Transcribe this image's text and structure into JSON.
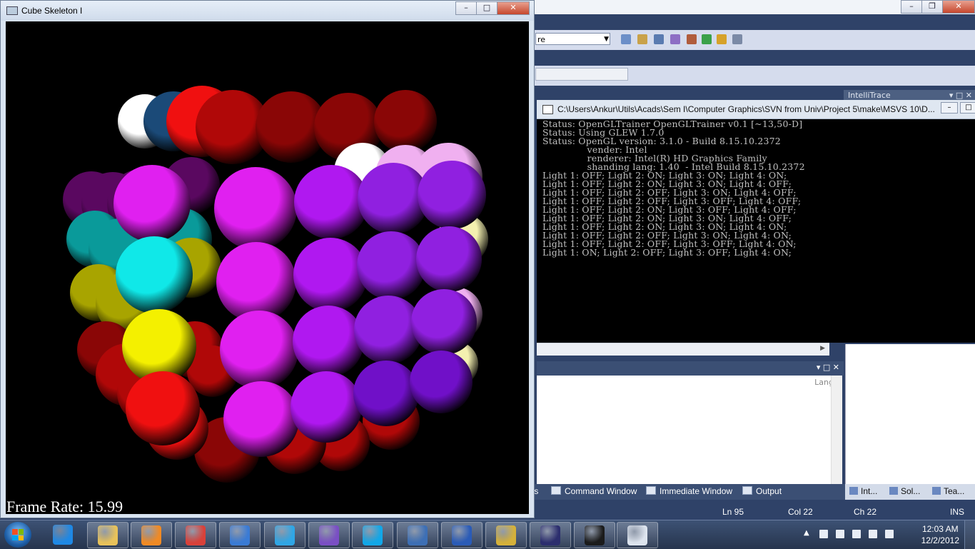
{
  "gl_window": {
    "title": "Cube Skeleton I",
    "frame_rate_text": "Frame Rate: 15.99"
  },
  "console_window": {
    "title": "C:\\Users\\Ankur\\Utils\\Acads\\Sem I\\Computer Graphics\\SVN from Univ\\Project 5\\make\\MSVS 10\\D...",
    "lines": [
      "Status: OpenGLTrainer OpenGLTrainer v0.1 [~13,50-D]",
      "Status: Using GLEW 1.7.0",
      "Status: OpenGL version: 3.1.0 - Build 8.15.10.2372",
      "               vender: Intel",
      "               renderer: Intel(R) HD Graphics Family",
      "               shanding lang: 1.40  - Intel Build 8.15.10.2372",
      "Light 1: OFF; Light 2: ON; Light 3: ON; Light 4: ON;",
      "Light 1: OFF; Light 2: ON; Light 3: ON; Light 4: OFF;",
      "Light 1: OFF; Light 2: OFF; Light 3: ON; Light 4: OFF;",
      "Light 1: OFF; Light 2: OFF; Light 3: OFF; Light 4: OFF;",
      "Light 1: OFF; Light 2: ON; Light 3: OFF; Light 4: OFF;",
      "Light 1: OFF; Light 2: ON; Light 3: ON; Light 4: OFF;",
      "Light 1: OFF; Light 2: ON; Light 3: ON; Light 4: ON;",
      "Light 1: OFF; Light 2: OFF; Light 3: ON; Light 4: ON;",
      "Light 1: OFF; Light 2: OFF; Light 3: OFF; Light 4: ON;",
      "Light 1: ON; Light 2: OFF; Light 3: OFF; Light 4: ON;"
    ]
  },
  "vs": {
    "config_combo_value": "re",
    "intellitrace_label": "IntelliTrace",
    "lang_header": "Lang",
    "bottom_tabs": [
      {
        "label": "ts",
        "icon": "tool-icon"
      },
      {
        "label": "Command Window",
        "icon": "command-window-icon"
      },
      {
        "label": "Immediate Window",
        "icon": "immediate-window-icon"
      },
      {
        "label": "Output",
        "icon": "output-icon"
      }
    ],
    "right_tabs": [
      "Int...",
      "Sol...",
      "Tea..."
    ],
    "status": {
      "line": "Ln 95",
      "col": "Col 22",
      "ch": "Ch 22",
      "mode": "INS"
    }
  },
  "taskbar": {
    "apps": [
      {
        "name": "internet-explorer-icon",
        "color": "#1e88e5"
      },
      {
        "name": "file-explorer-icon",
        "color": "#e8c25a"
      },
      {
        "name": "media-player-icon",
        "color": "#f08a24"
      },
      {
        "name": "chrome-icon",
        "color": "#d9413a"
      },
      {
        "name": "text-editor-icon",
        "color": "#3a7bd5"
      },
      {
        "name": "twitter-icon",
        "color": "#2fa6e6"
      },
      {
        "name": "visual-studio-icon",
        "color": "#7a4fc4"
      },
      {
        "name": "skype-icon",
        "color": "#11a7e8"
      },
      {
        "name": "thunderbird-icon",
        "color": "#3d6fb5"
      },
      {
        "name": "word-icon",
        "color": "#2a5bb7"
      },
      {
        "name": "counter-strike-icon",
        "color": "#d5b13a"
      },
      {
        "name": "eclipse-icon",
        "color": "#2c2e6e"
      },
      {
        "name": "console-app-icon",
        "color": "#1b1b1b"
      },
      {
        "name": "opengl-app-icon",
        "color": "#dde4ee"
      }
    ],
    "clock_time": "12:03 AM",
    "clock_date": "12/2/2012"
  }
}
